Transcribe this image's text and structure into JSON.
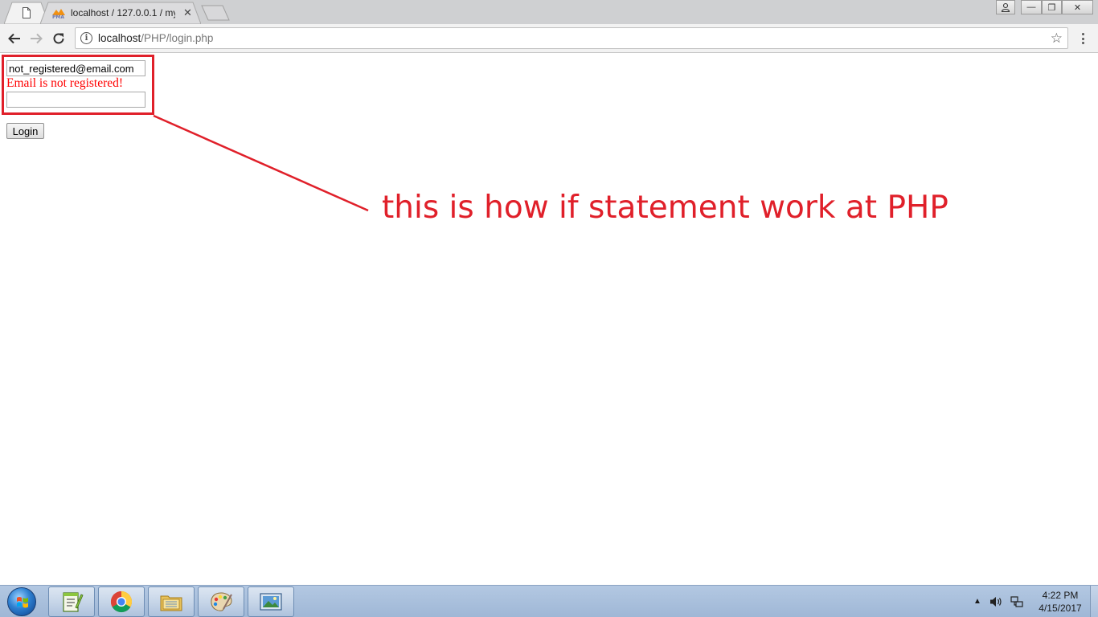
{
  "browser": {
    "tabs": [
      {
        "title": "",
        "icon": "page-icon",
        "active": true
      },
      {
        "title": "localhost / 127.0.0.1 / my",
        "icon": "phpmyadmin-icon",
        "active": false
      }
    ],
    "close_tab_glyph": "✕",
    "window_controls": {
      "minimize": "—",
      "maximize": "❐",
      "close": "✕"
    },
    "address": {
      "host": "localhost",
      "path": "/PHP/login.php"
    }
  },
  "page": {
    "email_value": "not_registered@email.com",
    "error_message": "Email is not registered!",
    "password_value": "",
    "login_label": "Login"
  },
  "annotation": {
    "text": "this is how if statement work at PHP",
    "color": "#e0202a"
  },
  "taskbar": {
    "apps": [
      "notepad-plus-plus-icon",
      "chrome-icon",
      "file-explorer-icon",
      "paint-icon",
      "image-viewer-icon"
    ],
    "time": "4:22 PM",
    "date": "4/15/2017"
  }
}
